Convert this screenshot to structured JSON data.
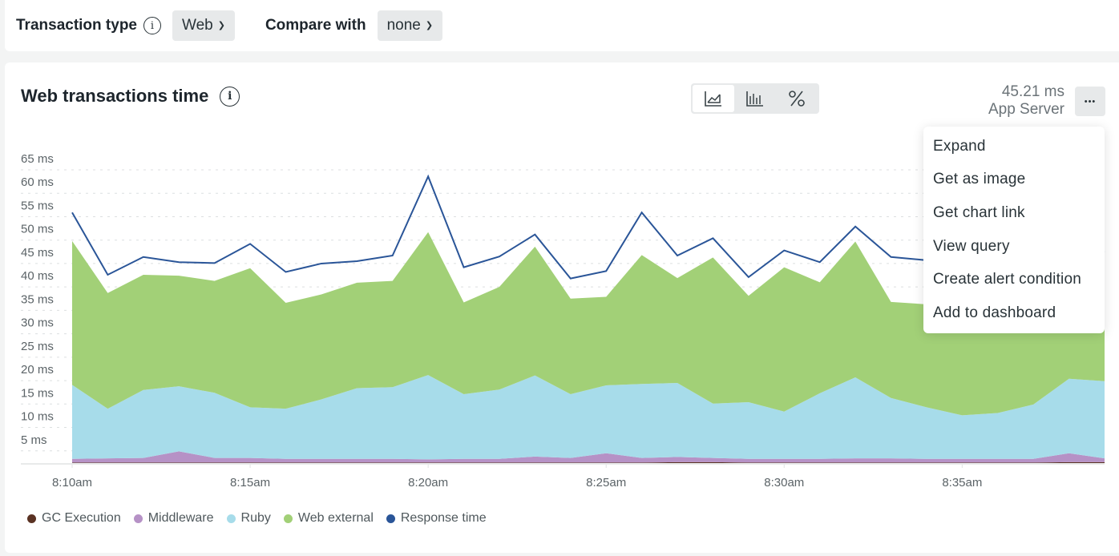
{
  "filters": {
    "transaction_type_label": "Transaction type",
    "transaction_type_value": "Web",
    "compare_with_label": "Compare with",
    "compare_with_value": "none"
  },
  "card": {
    "title": "Web transactions time",
    "summary_value": "45.21 ms",
    "summary_label": "App Server",
    "more_label": "•••",
    "viz_options": [
      {
        "name": "area-chart",
        "active": true
      },
      {
        "name": "bar-chart",
        "active": false
      },
      {
        "name": "percent",
        "active": false
      }
    ]
  },
  "menu": {
    "items": [
      "Expand",
      "Get as image",
      "Get chart link",
      "View query",
      "Create alert condition",
      "Add to dashboard"
    ]
  },
  "colors": {
    "gc": "#5a3223",
    "middleware": "#b692c6",
    "ruby": "#a7dcea",
    "web_external": "#a2d077",
    "response_time": "#2a5598"
  },
  "chart_data": {
    "type": "area",
    "stacked": true,
    "title": "Web transactions time",
    "xlabel": "",
    "ylabel": "",
    "ylim": [
      0,
      65
    ],
    "grid": true,
    "legend_position": "bottom-left",
    "y_ticks": [
      "5 ms",
      "10 ms",
      "15 ms",
      "20 ms",
      "25 ms",
      "30 ms",
      "35 ms",
      "40 ms",
      "45 ms",
      "50 ms",
      "55 ms",
      "60 ms",
      "65 ms"
    ],
    "y_tick_values": [
      5,
      10,
      15,
      20,
      25,
      30,
      35,
      40,
      45,
      50,
      55,
      60,
      65
    ],
    "x_ticks": [
      "8:10am",
      "8:15am",
      "8:20am",
      "8:25am",
      "8:30am",
      "8:35am"
    ],
    "x_tick_indices": [
      0,
      5,
      10,
      15,
      20,
      25
    ],
    "x": [
      "8:10",
      "8:11",
      "8:12",
      "8:13",
      "8:14",
      "8:15",
      "8:16",
      "8:17",
      "8:18",
      "8:19",
      "8:20",
      "8:21",
      "8:22",
      "8:23",
      "8:24",
      "8:25",
      "8:26",
      "8:27",
      "8:28",
      "8:29",
      "8:30",
      "8:31",
      "8:32",
      "8:33",
      "8:34",
      "8:35",
      "8:36",
      "8:37",
      "8:38",
      "8:39"
    ],
    "series": [
      {
        "name": "GC Execution",
        "key": "gc",
        "values": [
          0.1,
          0.1,
          0.1,
          0.1,
          0.1,
          0.1,
          0.1,
          0.1,
          0.1,
          0.1,
          0.1,
          0.1,
          0.1,
          0.1,
          0.1,
          0.1,
          0.1,
          0.2,
          0.2,
          0.1,
          0.1,
          0.1,
          0.1,
          0.1,
          0.1,
          0.1,
          0.1,
          0.1,
          0.2,
          0.2
        ]
      },
      {
        "name": "Middleware",
        "key": "middleware",
        "values": [
          0.8,
          0.9,
          1.0,
          2.4,
          1.0,
          1.0,
          0.8,
          0.8,
          0.8,
          0.8,
          0.7,
          0.8,
          0.8,
          1.3,
          1.0,
          2.0,
          1.0,
          1.1,
          0.9,
          0.8,
          0.8,
          0.8,
          0.9,
          0.9,
          0.8,
          0.8,
          0.8,
          0.8,
          1.9,
          0.8
        ]
      },
      {
        "name": "Ruby",
        "key": "ruby",
        "values": [
          15.8,
          10.6,
          14.5,
          13.9,
          13.9,
          10.8,
          10.7,
          12.7,
          15.1,
          15.3,
          18.0,
          13.8,
          14.8,
          17.3,
          13.6,
          14.5,
          15.8,
          15.8,
          11.6,
          12.1,
          10.1,
          14.0,
          17.3,
          12.9,
          11.0,
          9.3,
          9.8,
          11.6,
          15.9,
          16.5
        ]
      },
      {
        "name": "Web external",
        "key": "web_external",
        "values": [
          30.7,
          24.7,
          24.6,
          23.6,
          23.9,
          29.7,
          22.6,
          22.4,
          22.5,
          22.7,
          30.5,
          19.6,
          21.9,
          27.5,
          20.4,
          18.9,
          27.5,
          22.4,
          31.2,
          22.7,
          30.8,
          23.7,
          29.0,
          20.5,
          22.0,
          25.8,
          27.5,
          30.0,
          23.3,
          27.5
        ]
      },
      {
        "name": "Response time",
        "key": "response_time",
        "type": "line",
        "values": [
          53.5,
          40.2,
          44.0,
          42.9,
          42.7,
          46.8,
          40.8,
          42.6,
          43.1,
          44.3,
          61.2,
          41.8,
          44.1,
          48.8,
          39.4,
          41.0,
          53.5,
          44.3,
          48.0,
          39.7,
          45.4,
          42.9,
          50.5,
          44.0,
          43.3,
          40.0,
          41.5,
          43.5,
          46.0,
          45.0
        ]
      }
    ]
  },
  "legend": [
    {
      "label": "GC Execution",
      "key": "gc"
    },
    {
      "label": "Middleware",
      "key": "middleware"
    },
    {
      "label": "Ruby",
      "key": "ruby"
    },
    {
      "label": "Web external",
      "key": "web_external"
    },
    {
      "label": "Response time",
      "key": "response_time"
    }
  ]
}
